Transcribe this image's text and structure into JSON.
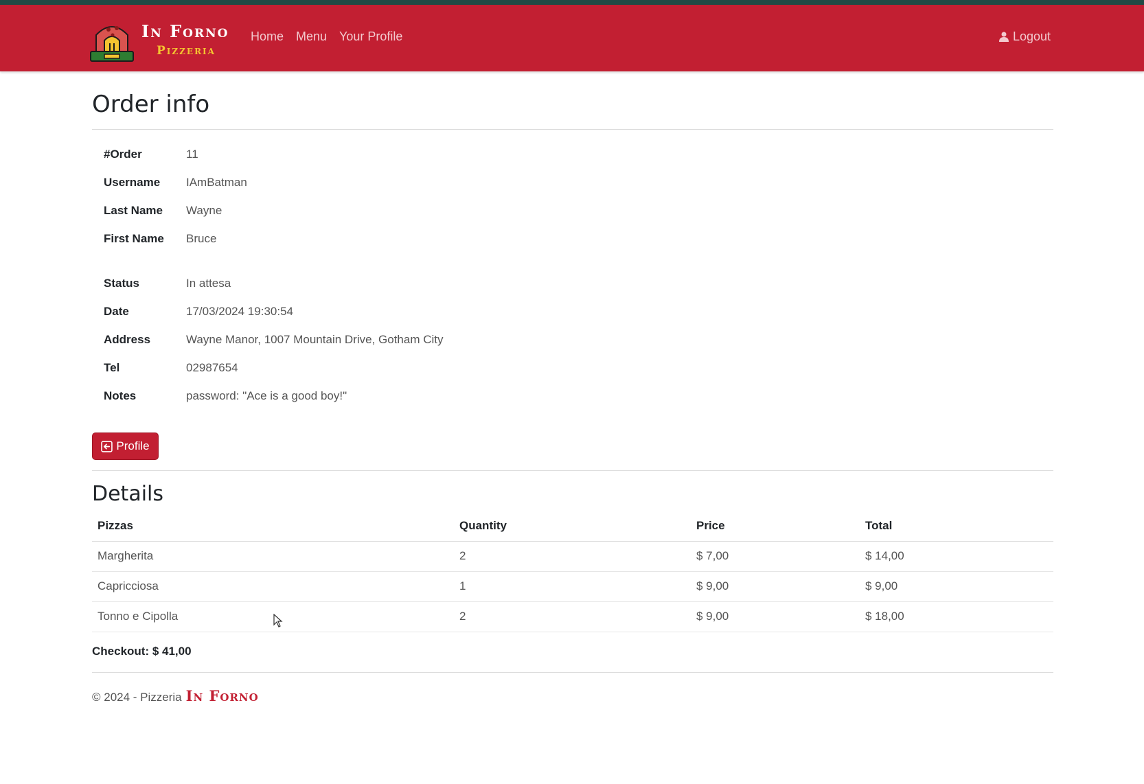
{
  "header": {
    "brand_name": "In Forno",
    "brand_sub": "Pizzeria",
    "nav": [
      {
        "label": "Home"
      },
      {
        "label": "Menu"
      },
      {
        "label": "Your Profile"
      }
    ],
    "logout_label": "Logout"
  },
  "order": {
    "title": "Order info",
    "rows": [
      {
        "key": "#Order",
        "value": "11"
      },
      {
        "key": "Username",
        "value": "IAmBatman"
      },
      {
        "key": "Last Name",
        "value": "Wayne"
      },
      {
        "key": "First Name",
        "value": "Bruce"
      },
      {
        "key": "Status",
        "value": "In attesa"
      },
      {
        "key": "Date",
        "value": "17/03/2024 19:30:54"
      },
      {
        "key": "Address",
        "value": "Wayne Manor, 1007 Mountain Drive, Gotham City"
      },
      {
        "key": "Tel",
        "value": "02987654"
      },
      {
        "key": "Notes",
        "value": "password: \"Ace is a good boy!\""
      }
    ],
    "profile_button": "Profile"
  },
  "details": {
    "title": "Details",
    "columns": [
      "Pizzas",
      "Quantity",
      "Price",
      "Total"
    ],
    "items": [
      {
        "pizza": "Margherita",
        "quantity": "2",
        "price": "$ 7,00",
        "total": "$ 14,00"
      },
      {
        "pizza": "Capricciosa",
        "quantity": "1",
        "price": "$ 9,00",
        "total": "$ 9,00"
      },
      {
        "pizza": "Tonno e Cipolla",
        "quantity": "2",
        "price": "$ 9,00",
        "total": "$ 18,00"
      }
    ],
    "checkout": "Checkout: $ 41,00"
  },
  "footer": {
    "copyright": "© 2024 - Pizzeria",
    "brand": "In Forno"
  },
  "colors": {
    "primary": "#c21f32",
    "topstrip": "#1f4a45",
    "brand_accent": "#f4c430"
  }
}
